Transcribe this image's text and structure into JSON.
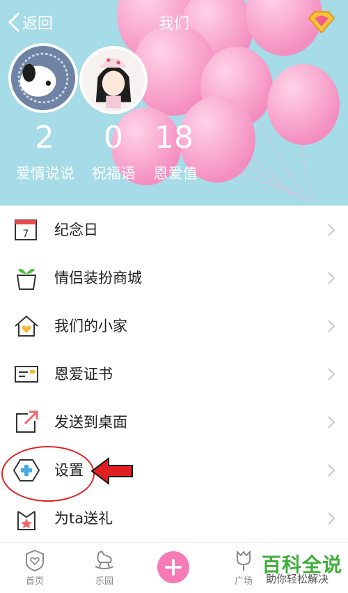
{
  "header": {
    "back_label": "返回",
    "title": "我们"
  },
  "stats": [
    {
      "value": "2",
      "label": "爱情说说"
    },
    {
      "value": "0",
      "label": "祝福语"
    },
    {
      "value": "18",
      "label": "恩爱值"
    }
  ],
  "menu": [
    {
      "label": "纪念日",
      "icon": "calendar-icon"
    },
    {
      "label": "情侣装扮商城",
      "icon": "plant-pot-icon"
    },
    {
      "label": "我们的小家",
      "icon": "home-icon"
    },
    {
      "label": "恩爱证书",
      "icon": "certificate-icon"
    },
    {
      "label": "发送到桌面",
      "icon": "share-to-desktop-icon"
    },
    {
      "label": "设置",
      "icon": "settings-hexagon-icon"
    },
    {
      "label": "为ta送礼",
      "icon": "gift-icon"
    }
  ],
  "calendar_day": "7",
  "tabs": [
    {
      "label": "首页",
      "icon": "heart-shield-icon"
    },
    {
      "label": "乐园",
      "icon": "rocking-horse-icon"
    },
    {
      "label": "",
      "icon": "plus-icon"
    },
    {
      "label": "广场",
      "icon": "tulip-icon"
    }
  ],
  "watermark": {
    "main": "百科全说",
    "sub": "助你轻松解决"
  },
  "colors": {
    "hero_bg": "#a6dbe8",
    "balloon": "#f59ac4",
    "accent_pink": "#f57ab6",
    "annotation_red": "#e02020",
    "watermark_green": "#3fae3a"
  }
}
